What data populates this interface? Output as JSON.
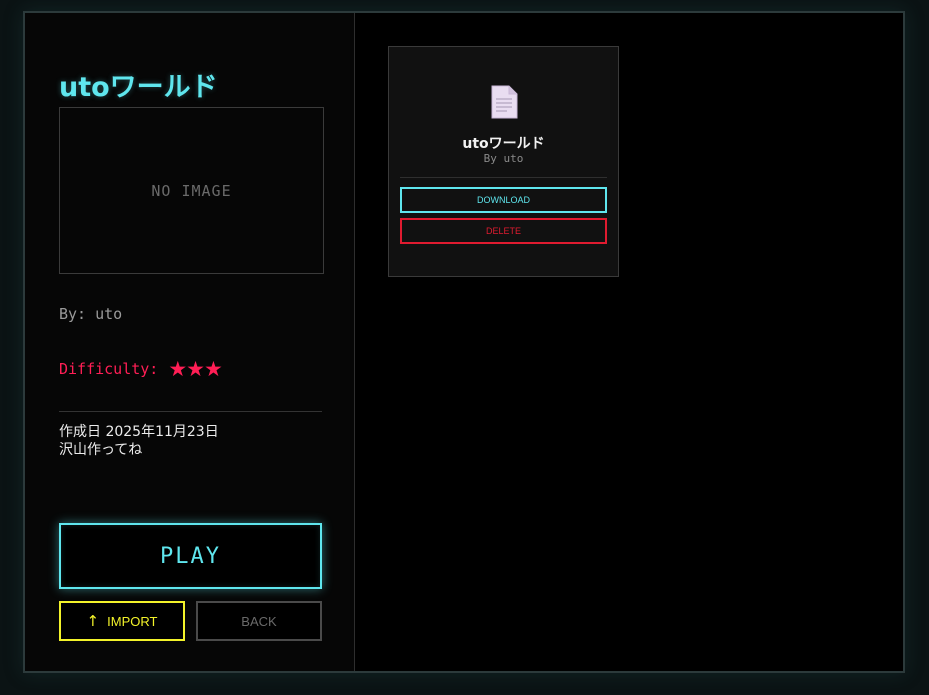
{
  "world": {
    "title": "utoワールド",
    "thumbnail_text": "NO IMAGE",
    "author_text": "By: uto",
    "difficulty_label": "Difficulty:",
    "difficulty_stars": "★★★",
    "created_text": "作成日 2025年11月23日",
    "description": "沢山作ってね"
  },
  "buttons": {
    "play": "PLAY",
    "import_icon": "↑",
    "import": "IMPORT",
    "back": "BACK"
  },
  "cards": [
    {
      "icon": "file-icon",
      "title": "utoワールド",
      "author": "By uto",
      "download": "DOWNLOAD",
      "delete": "DELETE"
    }
  ],
  "colors": {
    "accent_cyan": "#5fe6ee",
    "difficulty_red": "#ff1e55",
    "import_yellow": "#f3f32a",
    "delete_red": "#e01b30"
  }
}
